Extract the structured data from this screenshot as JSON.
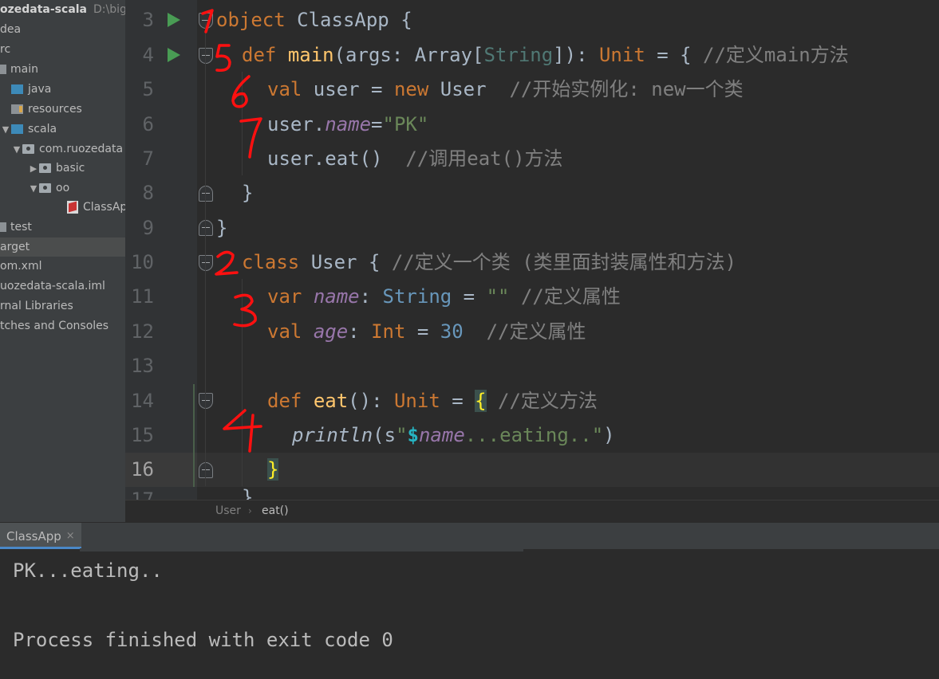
{
  "project_tree": [
    {
      "label": "ozedata-scala",
      "path": "D:\\bigdata",
      "bold": true
    },
    {
      "label": "dea"
    },
    {
      "label": "rc"
    },
    {
      "label": "main"
    },
    {
      "label": "java"
    },
    {
      "label": "resources"
    },
    {
      "label": "scala"
    },
    {
      "label": "com.ruozedata"
    },
    {
      "label": "basic"
    },
    {
      "label": "oo"
    },
    {
      "label": "ClassAp"
    },
    {
      "label": "test"
    },
    {
      "label": "arget"
    },
    {
      "label": "om.xml"
    },
    {
      "label": "uozedata-scala.iml"
    },
    {
      "label": "rnal Libraries"
    },
    {
      "label": "tches and Consoles"
    }
  ],
  "editor": {
    "line_numbers": [
      "3",
      "4",
      "5",
      "6",
      "7",
      "8",
      "9",
      "10",
      "11",
      "12",
      "13",
      "14",
      "15",
      "16",
      "17"
    ],
    "current_line": "16",
    "lines": {
      "l3": {
        "kw": "object",
        "name": "ClassApp",
        "rest": " {"
      },
      "l4": {
        "kw": "def",
        "name": "main",
        "p1": "(args: ",
        "ty": "Array",
        "lb": "[",
        "gen": "String",
        "rb": "]",
        "p2": "): ",
        "ret": "Unit",
        "p3": " = { ",
        "cmt": "//定义main方法"
      },
      "l5": {
        "kw": "val",
        "p1": " user = ",
        "kw2": "new",
        "p2": " User  ",
        "cmt": "//开始实例化: new一个类"
      },
      "l6": {
        "obj": "user.",
        "fld": "name",
        "eq": "=",
        "str": "\"PK\""
      },
      "l7": {
        "code": "user.eat()  ",
        "cmt": "//调用eat()方法"
      },
      "l8": {
        "code": "}"
      },
      "l9": {
        "code": "}"
      },
      "l10": {
        "kw": "class",
        "p1": " User { ",
        "cmt": "//定义一个类 (类里面封装属性和方法)"
      },
      "l11": {
        "kw": "var",
        "fld": "name",
        "p1": ": ",
        "ty": "String",
        "p2": " = ",
        "str": "\"\"",
        "p3": " ",
        "cmt": "//定义属性"
      },
      "l12": {
        "kw": "val",
        "fld": "age",
        "p1": ": ",
        "ty": "Int",
        "p2": " = ",
        "num": "30",
        "p3": "  ",
        "cmt": "//定义属性"
      },
      "l14": {
        "kw": "def",
        "name": "eat",
        "p1": "(): ",
        "ret": "Unit",
        "p2": " = ",
        "brace": "{",
        "p3": " ",
        "cmt": "//定义方法"
      },
      "l15": {
        "fn": "println",
        "p1": "(s",
        "q1": "\"",
        "dollar": "$",
        "fld": "name",
        "str": "...eating..",
        "q2": "\"",
        "p2": ")"
      },
      "l16": {
        "brace": "}"
      },
      "l17": {
        "code": "}"
      }
    }
  },
  "breadcrumb": [
    "User",
    "›",
    "eat()"
  ],
  "run": {
    "tab_label": "ClassApp",
    "tab_close": "×",
    "output": [
      "PK...eating..",
      "",
      "Process finished with exit code 0"
    ]
  },
  "annotations": [
    "1",
    "5",
    "6",
    "7",
    "2",
    "3",
    "4"
  ],
  "colors": {
    "editor_bg": "#2b2b2b",
    "keyword": "#cc7832",
    "function": "#ffc66d",
    "string": "#6a8759",
    "number": "#6897bb",
    "field": "#9876aa",
    "comment": "#808080",
    "annotation": "#ff1010"
  }
}
